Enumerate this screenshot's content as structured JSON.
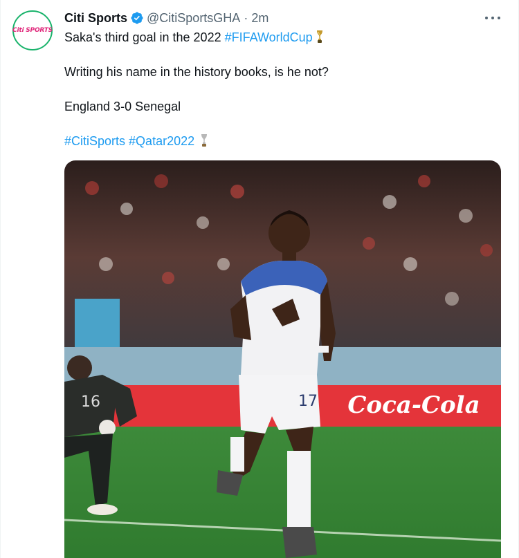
{
  "author": {
    "display_name": "Citi Sports",
    "handle": "@CitiSportsGHA",
    "time": "2m",
    "avatar_text": "Citi SPORTS",
    "verified": true
  },
  "more_icon": "more-horizontal-icon",
  "tweet": {
    "line1_text": "Saka's third goal in the 2022 ",
    "line1_hashtag": "#FIFAWorldCup",
    "line2": "Writing his name in the history books, is he not?",
    "line3": "England 3-0 Senegal",
    "hashtag1": "#CitiSports",
    "hashtag2": "#Qatar2022",
    "emoji": "trophy-icon"
  },
  "media": {
    "banner_text": "Coca-Cola",
    "shirt_number": "17",
    "keeper_number": "16"
  },
  "colors": {
    "accent": "#1d9bf0",
    "avatar_ring": "#19b36b",
    "avatar_logo": "#e0267a",
    "secondary_text": "#536471"
  }
}
